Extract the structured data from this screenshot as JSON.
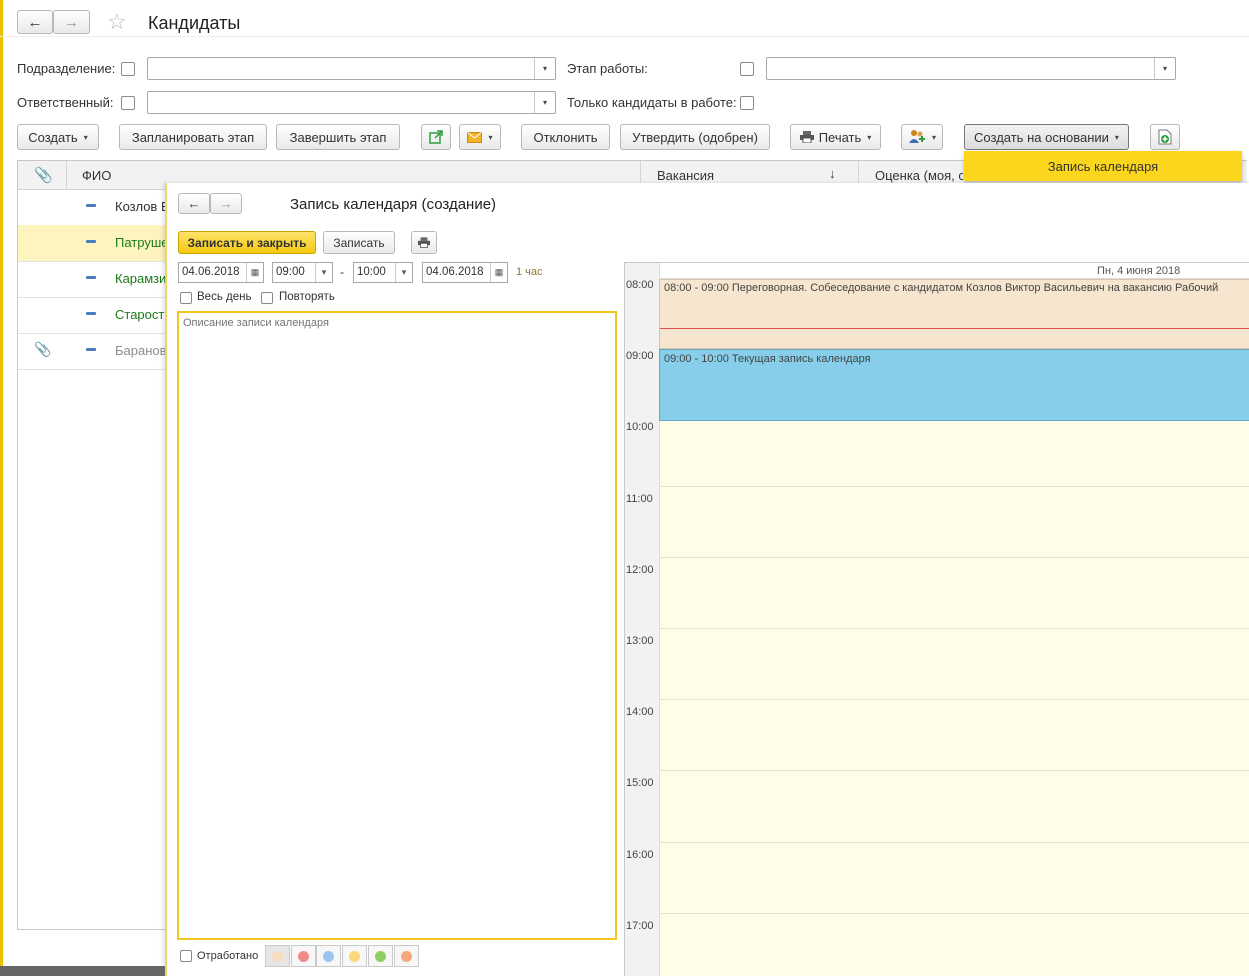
{
  "window": {
    "title": "Кандидаты",
    "nav_back": "🡐",
    "nav_forward": "🡒",
    "favorite_icon": "star-icon"
  },
  "filters": {
    "department_label": "Подразделение:",
    "department_value": "",
    "responsible_label": "Ответственный:",
    "responsible_value": "",
    "stage_label": "Этап работы:",
    "stage_value": "",
    "only_active_label": "Только кандидаты в работе:"
  },
  "toolbar": {
    "create": "Создать",
    "plan_stage": "Запланировать этап",
    "finish_stage": "Завершить этап",
    "reject": "Отклонить",
    "approve": "Утвердить (одобрен)",
    "print": "Печать",
    "create_based_on": "Создать на основании"
  },
  "dropdown": {
    "items": [
      "Запись календаря"
    ]
  },
  "table": {
    "columns": {
      "fio": "ФИО",
      "vacancy": "Вакансия",
      "vacancy_sort": "↓",
      "rating": "Оценка (моя, с"
    },
    "rows": [
      {
        "name": "Козлов В",
        "color": "#333333"
      },
      {
        "name": "Патруше",
        "color": "#1a7a1a"
      },
      {
        "name": "Карамзи",
        "color": "#1a7a1a"
      },
      {
        "name": "Старост",
        "color": "#1a7a1a"
      },
      {
        "name": "Баранов",
        "color": "#8c8c8c"
      }
    ]
  },
  "dialog": {
    "title": "Запись календаря (создание)",
    "save_close": "Записать и закрыть",
    "save": "Записать",
    "date_from": "04.06.2018",
    "time_from": "09:00",
    "dash": "-",
    "time_to": "10:00",
    "date_to": "04.06.2018",
    "duration": "1 час",
    "all_day": "Весь день",
    "repeat": "Повторять",
    "description_placeholder": "Описание записи календаря",
    "done_label": "Отработано",
    "swatch_colors": [
      "#f7dcc0",
      "#f28b8b",
      "#9cc4f0",
      "#fbd97a",
      "#8fcf5f",
      "#f7a878"
    ]
  },
  "calendar": {
    "day_header": "Пн, 4 июня 2018",
    "hours": [
      "08:00",
      "09:00",
      "10:00",
      "11:00",
      "12:00",
      "13:00",
      "14:00",
      "15:00",
      "16:00",
      "17:00"
    ],
    "events": [
      {
        "text": "08:00 - 09:00 Переговорная. Собеседование с кандидатом Козлов Виктор Васильевич на вакансию Рабочий",
        "color": "#f6e6cf"
      },
      {
        "text": "09:00 - 10:00 Текущая запись календаря",
        "color": "#87ceea"
      }
    ]
  }
}
